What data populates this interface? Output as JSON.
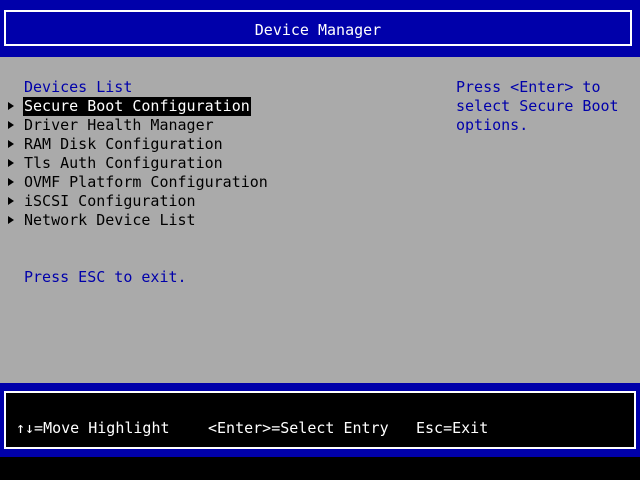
{
  "header": {
    "title": "Device Manager"
  },
  "main": {
    "section_title": "Devices List",
    "items": [
      {
        "label": "Secure Boot Configuration",
        "selected": true
      },
      {
        "label": "Driver Health Manager"
      },
      {
        "label": "RAM Disk Configuration"
      },
      {
        "label": "Tls Auth Configuration"
      },
      {
        "label": "OVMF Platform Configuration"
      },
      {
        "label": "iSCSI Configuration"
      },
      {
        "label": "Network Device List"
      }
    ],
    "exit_hint": "Press ESC to exit."
  },
  "help": {
    "lines": [
      "Press <Enter> to",
      "select Secure Boot",
      "options."
    ]
  },
  "footer": {
    "move": "↑↓=Move Highlight",
    "select": "<Enter>=Select Entry",
    "exit": "Esc=Exit"
  },
  "colors": {
    "title_bar": "#0000aa",
    "main_bg": "#aaaaaa",
    "link_text": "#0000aa",
    "selected_bg": "#000000",
    "selected_fg": "#ffffff"
  }
}
